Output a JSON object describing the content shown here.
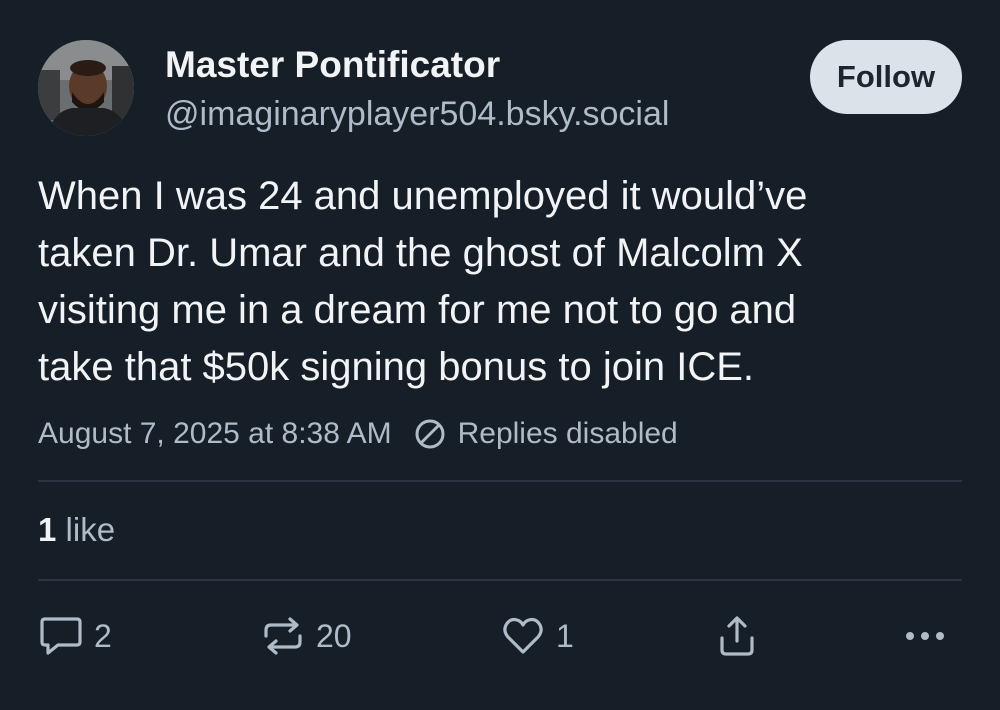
{
  "author": {
    "name": "Master Pontificator",
    "handle": "@imaginaryplayer504.bsky.social"
  },
  "follow_label": "Follow",
  "post": {
    "text": "When I was 24 and unemployed it would’ve\ntaken Dr. Umar and the ghost of Malcolm X\nvisiting me in a dream for me not to go and\ntake that $50k signing bonus to join ICE.",
    "timestamp": "August 7, 2025 at 8:38 AM",
    "replies_status": "Replies disabled"
  },
  "likes_summary": {
    "count": "1",
    "label": "like"
  },
  "actions": {
    "reply_count": "2",
    "repost_count": "20",
    "like_count": "1"
  },
  "icons": {
    "reply": "speech-bubble-icon",
    "repost": "repost-arrows-icon",
    "like": "heart-icon",
    "share": "share-upload-icon",
    "more": "more-dots-icon",
    "disabled": "circle-slash-icon"
  },
  "colors": {
    "background": "#161e27",
    "text_primary": "#f1f3f5",
    "text_secondary": "#aebbc9",
    "follow_button_bg": "#dce2ea",
    "divider": "#2a3541"
  }
}
